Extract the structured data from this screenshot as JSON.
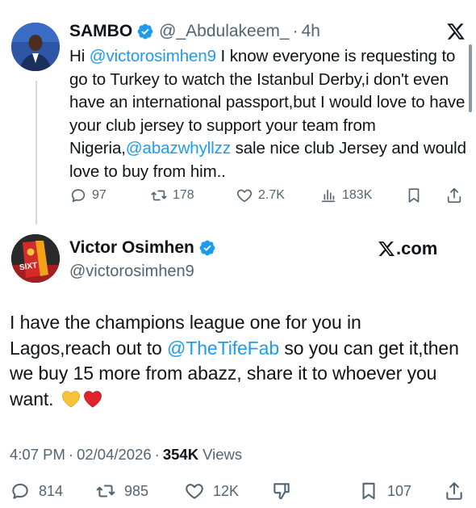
{
  "reply": {
    "display_name": "SAMBO",
    "handle": "@_Abdulakeem_",
    "separator": "·",
    "time_ago": "4h",
    "text_parts": [
      {
        "text": "Hi ",
        "mention": false
      },
      {
        "text": "@victorosimhen9",
        "mention": true
      },
      {
        "text": " I know everyone is requesting to go to Turkey to watch the Istanbul Derby,i don't even have an international passport,but I would love to have your club jersey to support your team from Nigeria,",
        "mention": false
      },
      {
        "text": "@abazwhyllzz",
        "mention": true
      },
      {
        "text": " sale nice club Jersey and would love to buy from him..",
        "mention": false
      }
    ],
    "stats": {
      "replies": "97",
      "reposts": "178",
      "likes": "2.7K",
      "views": "183K"
    }
  },
  "main": {
    "display_name": "Victor Osimhen",
    "handle": "@victorosimhen9",
    "brand": ".com",
    "text_parts": [
      {
        "text": "I have the champions league one for you in Lagos,reach out to ",
        "mention": false
      },
      {
        "text": "@TheTifeFab",
        "mention": true
      },
      {
        "text": " so you can get it,then we buy 15 more from abazz, share it to whoever you want.",
        "mention": false
      }
    ],
    "emojis": [
      "yellow-heart",
      "red-heart"
    ],
    "time": "4:07 PM",
    "date": "02/04/2026",
    "separator": "·",
    "views_count": "354K",
    "views_label": "Views",
    "stats": {
      "replies": "814",
      "reposts": "985",
      "likes": "12K",
      "bookmarks": "107"
    }
  },
  "colors": {
    "text": "#0f1419",
    "muted": "#536471",
    "link": "#1d9bf0",
    "verified": "#1d9bf0",
    "yellow_heart": "#f6c338",
    "red_heart": "#e0242e"
  },
  "icons": [
    "verified-badge-icon",
    "x-logo-icon",
    "reply-icon",
    "repost-icon",
    "like-icon",
    "views-icon",
    "bookmark-icon",
    "share-icon",
    "dislike-icon"
  ]
}
